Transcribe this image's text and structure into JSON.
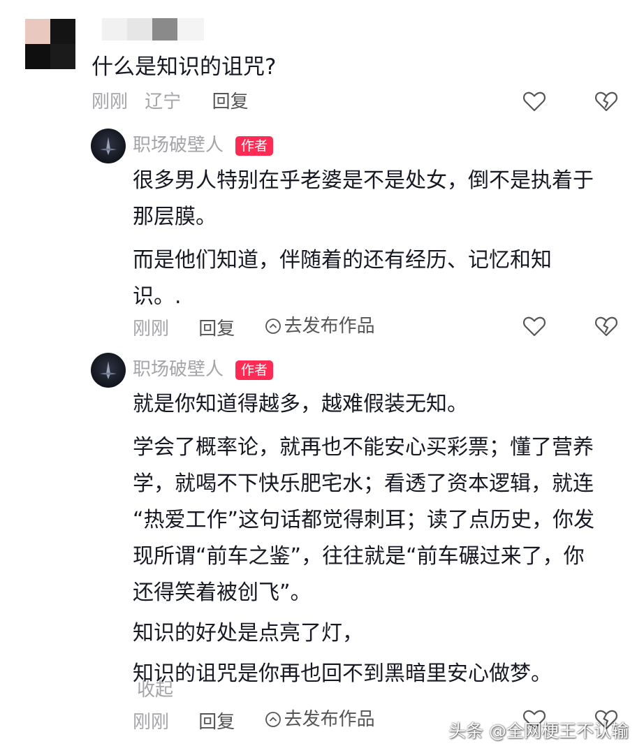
{
  "question": {
    "text": "什么是知识的诅咒?",
    "time": "刚刚",
    "location": "辽宁",
    "reply_label": "回复"
  },
  "replies": [
    {
      "username": "职场破壁人",
      "badge": "作者",
      "lines": [
        "很多男人特别在乎老婆是不是处女，倒不是执着于",
        "那层膜。",
        "而是他们知道，伴随着的还有经历、记忆和知",
        "识。."
      ],
      "time": "刚刚",
      "reply_label": "回复",
      "publish_label": "去发布作品"
    },
    {
      "username": "职场破壁人",
      "badge": "作者",
      "lines": [
        "就是你知道得越多，越难假装无知。",
        "学会了概率论，就再也不能安心买彩票；懂了营养",
        "学，就喝不下快乐肥宅水；看透了资本逻辑，就连",
        "“热爱工作”这句话都觉得刺耳；读了点历史，你发",
        "现所谓“前车之鉴”，往往就是“前车碾过来了，你",
        "还得笑着被创飞”。",
        "知识的好处是点亮了灯，",
        "知识的诅咒是你再也回不到黑暗里安心做梦。"
      ],
      "collapse_label": "收起",
      "time": "刚刚",
      "reply_label": "回复",
      "publish_label": "去发布作品"
    }
  ],
  "watermark": "头条 @全网梗王不认输",
  "colors": {
    "text": "#161823",
    "muted": "#a4a4a9",
    "badge": "#fe2c55"
  },
  "icons": [
    "heart-outline-icon",
    "broken-heart-icon",
    "publish-arrow-icon"
  ]
}
